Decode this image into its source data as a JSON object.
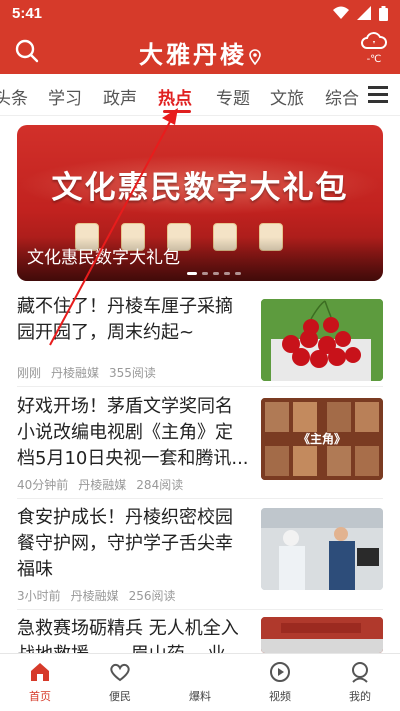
{
  "status": {
    "time": "5:41"
  },
  "header": {
    "logo": "大雅丹棱",
    "weather_temp": "-℃"
  },
  "tabs": [
    "头条",
    "学习",
    "政声",
    "热点",
    "专题",
    "文旅",
    "综合"
  ],
  "active_tab": "热点",
  "banner": {
    "headline": "文化惠民数字大礼包",
    "caption": "文化惠民数字大礼包"
  },
  "news": [
    {
      "title": "藏不住了！丹棱车厘子采摘园开园了，周末约起~",
      "time": "刚刚",
      "source": "丹棱融媒",
      "reads": "355阅读"
    },
    {
      "title": "好戏开场！茅盾文学奖同名小说改编电视剧《主角》定档5月10日央视一套和腾讯...",
      "time": "40分钟前",
      "source": "丹棱融媒",
      "reads": "284阅读"
    },
    {
      "title": "食安护成长！丹棱织密校园餐守护网，守护学子舌尖幸福味",
      "time": "3小时前",
      "source": "丹棱融媒",
      "reads": "256阅读"
    },
    {
      "title": "急救赛场砺精兵 无人机全入战地救援 ——眉山药... 业",
      "time": "",
      "source": "",
      "reads": ""
    }
  ],
  "thumb_labels": {
    "drama": "《主角》"
  },
  "bottom_nav": [
    {
      "label": "首页",
      "icon": "home-icon",
      "active": true
    },
    {
      "label": "便民",
      "icon": "heart-icon",
      "active": false
    },
    {
      "label": "爆料",
      "icon": "report-icon",
      "active": false
    },
    {
      "label": "视频",
      "icon": "play-icon",
      "active": false
    },
    {
      "label": "我的",
      "icon": "user-icon",
      "active": false
    }
  ],
  "colors": {
    "brand_red": "#d63a2a",
    "active_tab": "#e02020"
  }
}
